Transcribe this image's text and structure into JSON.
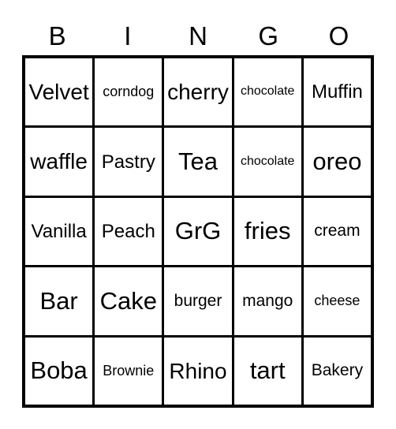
{
  "card": {
    "title": "BINGO",
    "header_letters": [
      "B",
      "I",
      "N",
      "G",
      "O"
    ],
    "colors": {
      "background": "#ffffff",
      "border": "#000000",
      "text": "#000000",
      "cell_background": "#ffffff"
    },
    "grid": {
      "rows": 5,
      "columns": 5,
      "cells": [
        [
          {
            "text": "Velvet",
            "size": "lg"
          },
          {
            "text": "corndog",
            "size": "xs"
          },
          {
            "text": "cherry",
            "size": "lg"
          },
          {
            "text": "chocolate",
            "size": "xxs"
          },
          {
            "text": "Muffin",
            "size": "md"
          }
        ],
        [
          {
            "text": "waffle",
            "size": "lg"
          },
          {
            "text": "Pastry",
            "size": "md"
          },
          {
            "text": "Tea",
            "size": "xl"
          },
          {
            "text": "chocolate",
            "size": "xxs"
          },
          {
            "text": "oreo",
            "size": "xl"
          }
        ],
        [
          {
            "text": "Vanilla",
            "size": "md"
          },
          {
            "text": "Peach",
            "size": "md"
          },
          {
            "text": "GrG",
            "size": "xl"
          },
          {
            "text": "fries",
            "size": "xl"
          },
          {
            "text": "cream",
            "size": "sm"
          }
        ],
        [
          {
            "text": "Bar",
            "size": "xl"
          },
          {
            "text": "Cake",
            "size": "xl"
          },
          {
            "text": "burger",
            "size": "sm"
          },
          {
            "text": "mango",
            "size": "sm"
          },
          {
            "text": "cheese",
            "size": "xs"
          }
        ],
        [
          {
            "text": "Boba",
            "size": "xl"
          },
          {
            "text": "Brownie",
            "size": "xs"
          },
          {
            "text": "Rhino",
            "size": "lg"
          },
          {
            "text": "tart",
            "size": "xl"
          },
          {
            "text": "Bakery",
            "size": "sm"
          }
        ]
      ]
    }
  }
}
